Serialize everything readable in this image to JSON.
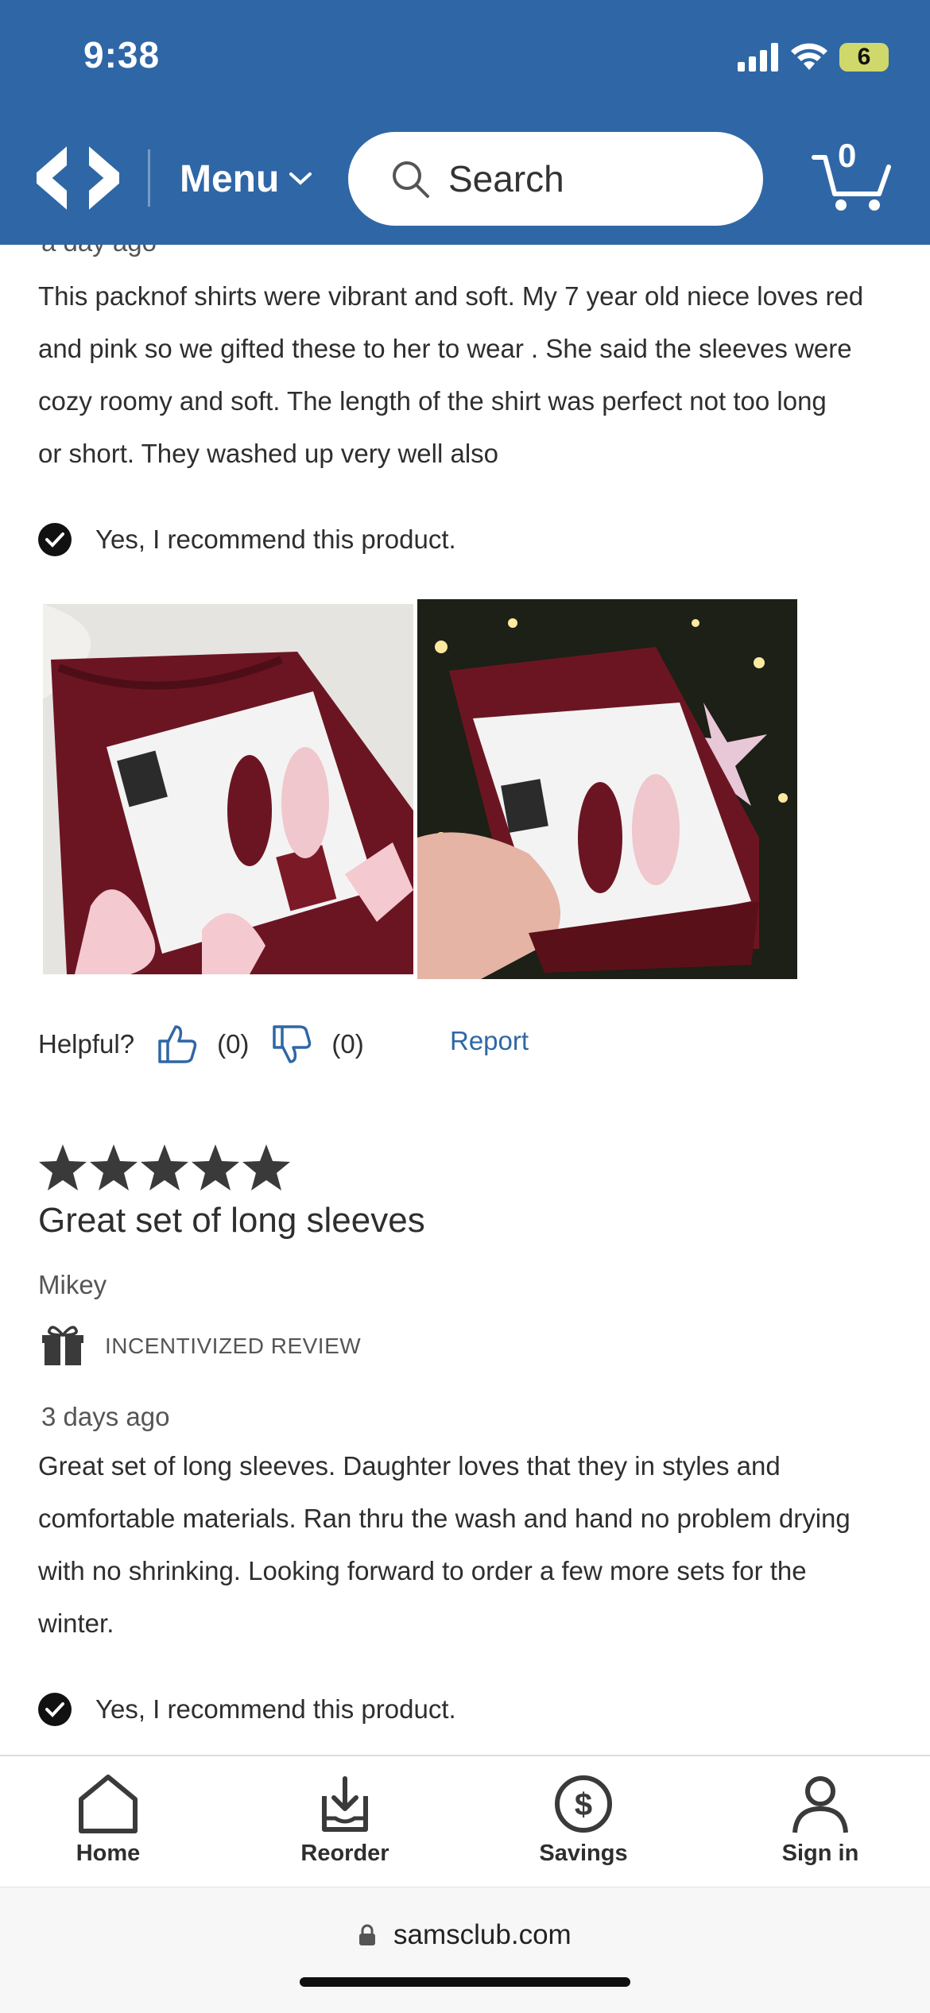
{
  "status_bar": {
    "time": "9:38",
    "battery": "6"
  },
  "header": {
    "menu_label": "Menu",
    "search_placeholder": "Search",
    "cart_count": "0"
  },
  "review1": {
    "date": "a day ago",
    "body_lines": [
      "This packnof shirts were vibrant and soft. My 7 year old niece loves red",
      "and pink so we gifted these to her to wear . She said the sleeves were",
      "cozy roomy and soft. The length of the shirt was perfect not too long",
      "or short. They washed up very well also"
    ],
    "recommend": "Yes, I recommend this product.",
    "helpful_label": "Helpful?",
    "up_count": "(0)",
    "down_count": "(0)",
    "report_label": "Report"
  },
  "review2": {
    "rating": 5,
    "title": "Great set of long sleeves",
    "author": "Mikey",
    "badge": "INCENTIVIZED REVIEW",
    "date": "3 days ago",
    "body_lines": [
      "Great set of long sleeves. Daughter loves that they in styles and",
      "comfortable materials. Ran thru the wash and hand no problem drying",
      "with no shrinking. Looking forward to order a few more sets for the",
      "winter."
    ],
    "recommend": "Yes, I recommend this product."
  },
  "bottom_nav": [
    {
      "label": "Home",
      "icon": "home-icon"
    },
    {
      "label": "Reorder",
      "icon": "reorder-icon"
    },
    {
      "label": "Savings",
      "icon": "savings-icon"
    },
    {
      "label": "Sign in",
      "icon": "person-icon"
    }
  ],
  "browser": {
    "url": "samsclub.com"
  },
  "colors": {
    "brand_blue": "#2f67a6",
    "text": "#2e2e2e"
  }
}
